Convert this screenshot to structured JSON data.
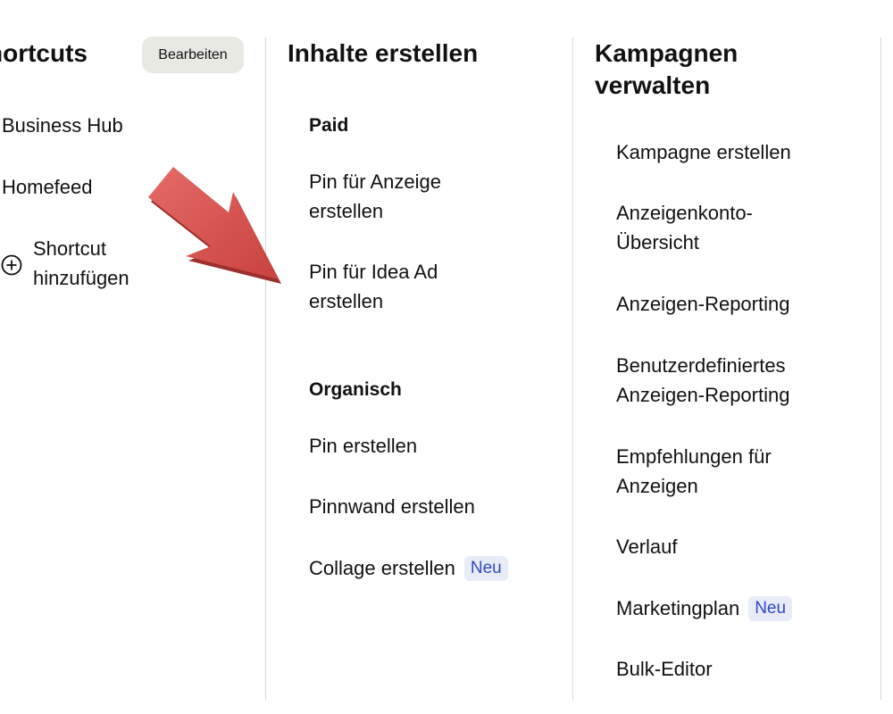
{
  "shortcuts": {
    "title": "hortcuts",
    "edit_label": "Bearbeiten",
    "items": [
      "Business Hub",
      "Homefeed"
    ],
    "add_label_line1": "Shortcut",
    "add_label_line2": "hinzufügen"
  },
  "create": {
    "title": "Inhalte erstellen",
    "paid_header": "Paid",
    "paid_items": [
      {
        "line1": "Pin für Anzeige",
        "line2": "erstellen"
      },
      {
        "line1": "Pin für Idea Ad",
        "line2": "erstellen"
      }
    ],
    "organic_header": "Organisch",
    "organic_items": [
      "Pin erstellen",
      "Pinnwand erstellen",
      "Collage erstellen"
    ],
    "collage_badge": "Neu"
  },
  "manage": {
    "title": "Kampagnen verwalten",
    "items": [
      {
        "line1": "Kampagne erstellen"
      },
      {
        "line1": "Anzeigenkonto-",
        "line2": "Übersicht"
      },
      {
        "line1": "Anzeigen-Reporting"
      },
      {
        "line1": "Benutzerdefiniertes",
        "line2": "Anzeigen-Reporting"
      },
      {
        "line1": "Empfehlungen für",
        "line2": "Anzeigen"
      },
      {
        "line1": "Verlauf"
      },
      {
        "line1": "Marketingplan"
      },
      {
        "line1": "Bulk-Editor"
      }
    ],
    "marketing_badge": "Neu"
  },
  "annotation": {
    "icon": "arrow-icon",
    "color": "#d9534f"
  }
}
